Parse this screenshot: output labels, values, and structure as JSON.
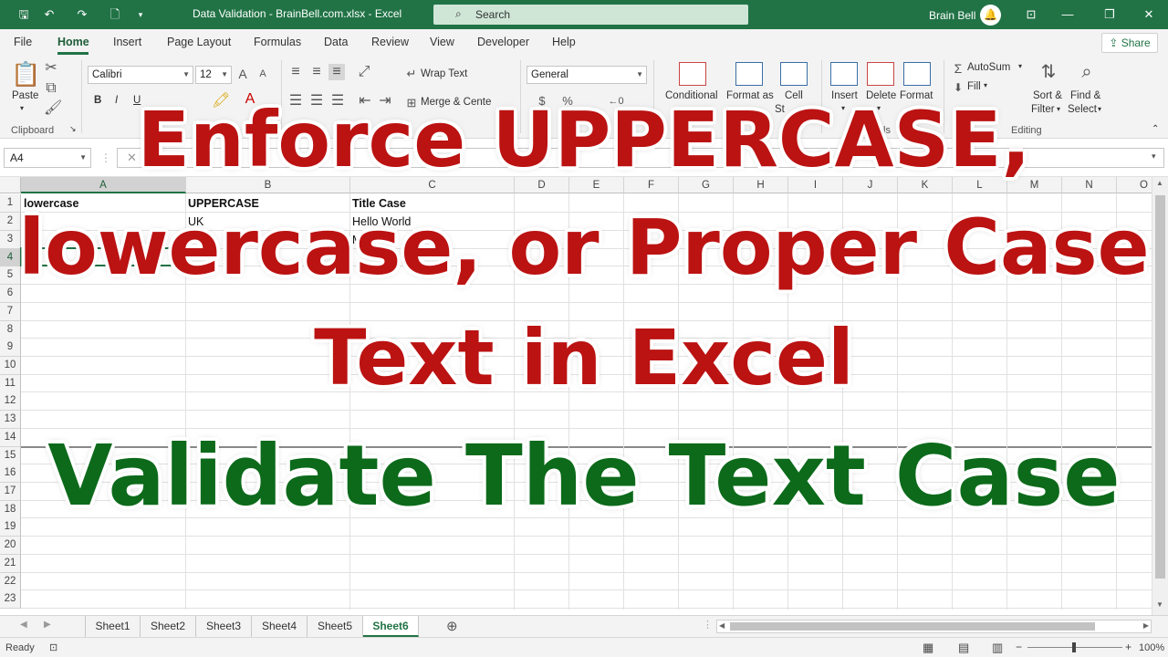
{
  "window": {
    "title": "Data Validation - BrainBell.com.xlsx  -  Excel",
    "search_placeholder": "Search",
    "user_name": "Brain Bell"
  },
  "ribbon_tabs": [
    "File",
    "Home",
    "Insert",
    "Page Layout",
    "Formulas",
    "Data",
    "Review",
    "View",
    "Developer",
    "Help"
  ],
  "share_label": "Share",
  "ribbon": {
    "clipboard": {
      "paste": "Paste",
      "group": "Clipboard"
    },
    "font": {
      "name": "Calibri",
      "size": "12",
      "bold": "B",
      "italic": "I",
      "underline": "U"
    },
    "alignment": {
      "wrap_text": "Wrap Text",
      "merge_center": "Merge & Cente"
    },
    "number": {
      "format": "General"
    },
    "styles": {
      "conditional": "Conditional",
      "format_as": "Format as",
      "cell": "Cell",
      "cell_second": "St"
    },
    "cells": {
      "insert": "Insert",
      "delete": "Delete",
      "format": "Format",
      "group_fragment": "ls"
    },
    "editing": {
      "autosum": "AutoSum",
      "fill": "Fill",
      "sort_filter_1": "Sort &",
      "sort_filter_2": "Filter",
      "find_select_1": "Find &",
      "find_select_2": "Select",
      "group": "Editing"
    }
  },
  "name_box": "A4",
  "columns": [
    "A",
    "B",
    "C",
    "D",
    "E",
    "F",
    "G",
    "H",
    "I",
    "J",
    "K",
    "L",
    "M",
    "N",
    "O"
  ],
  "rows": [
    "1",
    "2",
    "3",
    "4",
    "5",
    "6",
    "7",
    "8",
    "9",
    "10",
    "11",
    "12",
    "13",
    "14",
    "15",
    "16",
    "17",
    "18",
    "19",
    "20",
    "21",
    "22",
    "23"
  ],
  "cells": {
    "a1": "lowercase",
    "b1": "UPPERCASE",
    "c1": "Title Case",
    "b2": "UK",
    "c2": "Hello World",
    "c3": "M"
  },
  "sheets": [
    "Sheet1",
    "Sheet2",
    "Sheet3",
    "Sheet4",
    "Sheet5",
    "Sheet6"
  ],
  "active_sheet": "Sheet6",
  "status": {
    "ready": "Ready",
    "zoom": "100%"
  },
  "overlay": {
    "line1": "Enforce UPPERCASE,",
    "line2": "lowercase, or Proper Case",
    "line3": "Text in Excel",
    "line4": "Validate The Text Case",
    "red": "#bb1212",
    "green": "#0c6a1a"
  },
  "colors": {
    "excel_green": "#217346"
  }
}
